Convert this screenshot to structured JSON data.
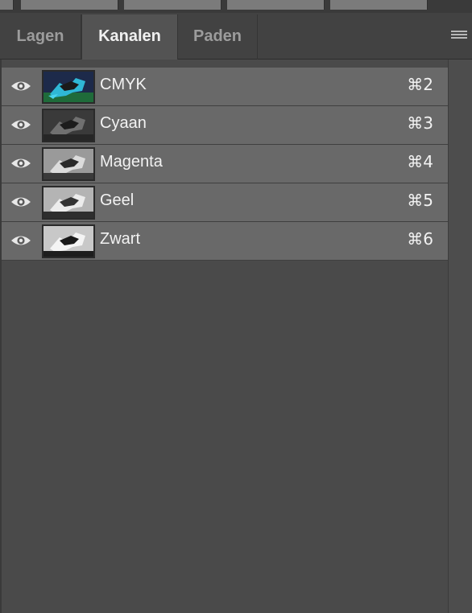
{
  "tabs": [
    {
      "label": "Lagen",
      "active": false
    },
    {
      "label": "Kanalen",
      "active": true
    },
    {
      "label": "Paden",
      "active": false
    }
  ],
  "channels": [
    {
      "name": "CMYK",
      "shortcut": "⌘2",
      "visible": true,
      "thumbnail": "frog-color"
    },
    {
      "name": "Cyaan",
      "shortcut": "⌘3",
      "visible": true,
      "thumbnail": "frog-gray-dark"
    },
    {
      "name": "Magenta",
      "shortcut": "⌘4",
      "visible": true,
      "thumbnail": "frog-gray-light"
    },
    {
      "name": "Geel",
      "shortcut": "⌘5",
      "visible": true,
      "thumbnail": "frog-gray-lighter"
    },
    {
      "name": "Zwart",
      "shortcut": "⌘6",
      "visible": true,
      "thumbnail": "frog-gray-lightest"
    }
  ],
  "icons": {
    "visibility": "eye-icon",
    "panel_menu": "hamburger-menu-icon"
  }
}
